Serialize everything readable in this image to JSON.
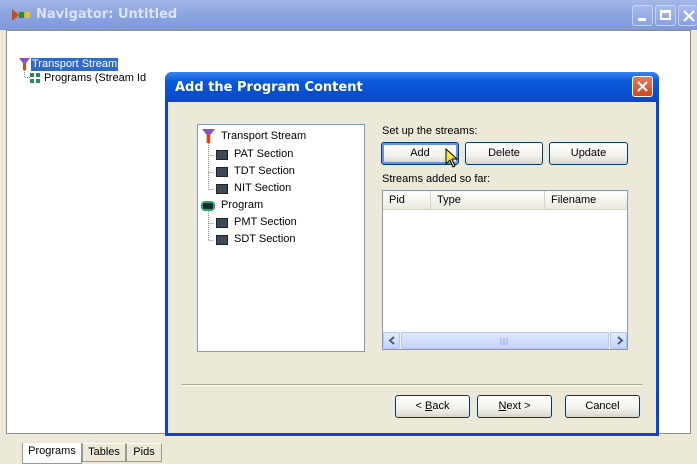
{
  "outer_window": {
    "title": "Navigator: Untitled",
    "tree": {
      "root_label": "Transport Stream",
      "child_label": "Programs (Stream Id"
    },
    "tabs": [
      {
        "label": "Programs",
        "active": true
      },
      {
        "label": "Tables",
        "active": false
      },
      {
        "label": "Pids",
        "active": false
      }
    ]
  },
  "dialog": {
    "title": "Add the Program Content",
    "tree": [
      {
        "label": "Transport Stream",
        "icon": "transport-stream-icon"
      },
      {
        "label": "PAT Section",
        "icon": "section-icon"
      },
      {
        "label": "TDT Section",
        "icon": "section-icon"
      },
      {
        "label": "NIT Section",
        "icon": "section-icon"
      },
      {
        "label": "Program",
        "icon": "program-icon"
      },
      {
        "label": "PMT Section",
        "icon": "section-icon"
      },
      {
        "label": "SDT Section",
        "icon": "section-icon"
      }
    ],
    "setup_label": "Set up the streams:",
    "buttons": {
      "add": "Add",
      "delete": "Delete",
      "update": "Update"
    },
    "streams_label": "Streams added so far:",
    "columns": [
      "Pid",
      "Type",
      "Filename"
    ],
    "rows": [],
    "nav": {
      "back_prefix": "< ",
      "back_key": "B",
      "back_rest": "ack",
      "next_key": "N",
      "next_rest": "ext >",
      "cancel": "Cancel"
    }
  },
  "colors": {
    "dialog_title": "#0a4fd0",
    "inactive_title": "#8fa6e0",
    "selection": "#316ac5"
  }
}
